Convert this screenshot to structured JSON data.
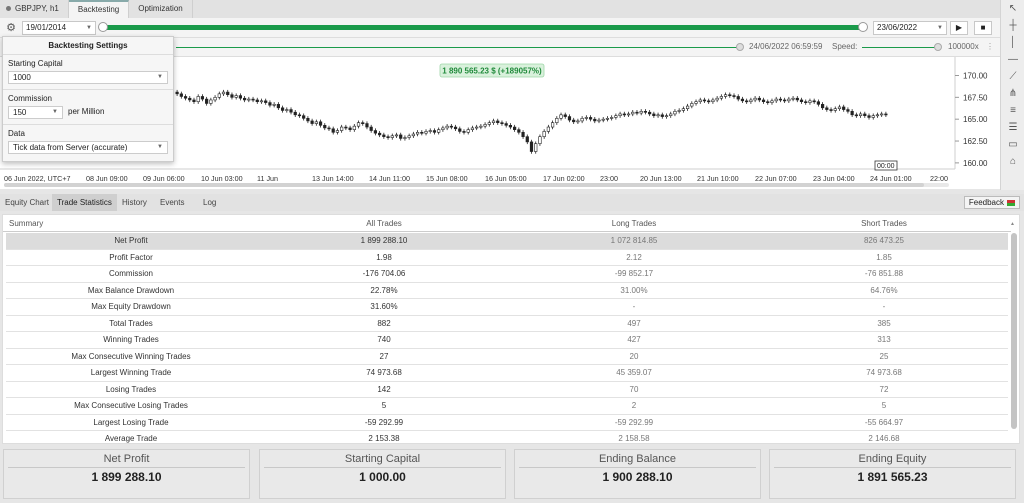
{
  "top_tabs": [
    {
      "label": "GBPJPY, h1"
    },
    {
      "label": "Backtesting"
    },
    {
      "label": "Optimization"
    }
  ],
  "control_bar": {
    "start_date": "19/01/2014",
    "end_date": "23/06/2022",
    "play_icon": "▶",
    "stop_icon": "■"
  },
  "speed_row": {
    "current_time": "24/06/2022 06:59:59",
    "speed_label": "Speed:",
    "speed_value": "100000x"
  },
  "settings": {
    "title": "Backtesting Settings",
    "starting_capital_label": "Starting Capital",
    "starting_capital_value": "1000",
    "commission_label": "Commission",
    "commission_value": "150",
    "commission_unit": "per Million",
    "data_label": "Data",
    "data_value": "Tick data from Server (accurate)"
  },
  "chart": {
    "equity_badge": "1 890 565.23 $ (+189057%)",
    "price_ticks": [
      "170.00",
      "167.50",
      "165.00",
      "162.50",
      "160.00"
    ],
    "time_ticks": [
      "06 Jun 2022, UTC+7",
      "08 Jun 09:00",
      "09 Jun 06:00",
      "10 Jun 03:00",
      "11 Jun",
      "13 Jun 14:00",
      "14 Jun 11:00",
      "15 Jun 08:00",
      "16 Jun 05:00",
      "17 Jun 02:00",
      "23:00",
      "20 Jun 13:00",
      "21 Jun 10:00",
      "22 Jun 07:00",
      "23 Jun 04:00",
      "24 Jun 01:00",
      "22:00"
    ],
    "time_marker": "00:00"
  },
  "chart_data": {
    "type": "candlestick",
    "title": "",
    "y_ticks": [
      160.0,
      162.5,
      165.0,
      167.5,
      170.0
    ],
    "ylim": [
      159.3,
      171.2
    ],
    "grid": false,
    "close": [
      167.9,
      167.6,
      167.4,
      167.2,
      167.0,
      167.6,
      167.3,
      166.8,
      167.2,
      167.5,
      167.9,
      168.1,
      167.8,
      167.5,
      167.7,
      167.4,
      167.2,
      167.3,
      167.2,
      167.0,
      167.1,
      166.9,
      166.6,
      166.7,
      166.3,
      166.0,
      166.1,
      165.8,
      165.5,
      165.4,
      165.1,
      164.8,
      164.5,
      164.7,
      164.3,
      164.0,
      163.9,
      163.5,
      163.7,
      164.1,
      164.0,
      163.8,
      164.2,
      164.6,
      164.5,
      164.1,
      163.7,
      163.4,
      163.2,
      163.0,
      162.9,
      163.1,
      163.2,
      162.8,
      162.9,
      163.1,
      163.3,
      163.5,
      163.4,
      163.6,
      163.7,
      163.5,
      163.8,
      164.0,
      164.2,
      164.1,
      163.9,
      163.6,
      163.5,
      163.8,
      164.0,
      164.1,
      164.2,
      164.4,
      164.6,
      164.8,
      164.6,
      164.5,
      164.3,
      164.1,
      163.8,
      163.5,
      163.0,
      162.4,
      161.3,
      162.2,
      163.0,
      163.6,
      164.1,
      164.6,
      165.1,
      165.5,
      165.3,
      164.9,
      164.7,
      164.8,
      165.1,
      165.2,
      165.0,
      164.8,
      164.9,
      165.0,
      165.1,
      165.2,
      165.4,
      165.6,
      165.5,
      165.6,
      165.8,
      165.7,
      165.9,
      165.8,
      165.6,
      165.4,
      165.5,
      165.3,
      165.4,
      165.6,
      165.9,
      166.0,
      166.2,
      166.5,
      166.8,
      167.0,
      167.2,
      167.1,
      167.0,
      167.2,
      167.4,
      167.6,
      167.8,
      167.7,
      167.6,
      167.3,
      167.1,
      167.0,
      167.2,
      167.4,
      167.2,
      167.0,
      166.9,
      167.1,
      167.3,
      167.2,
      167.1,
      167.3,
      167.4,
      167.2,
      167.0,
      166.9,
      167.1,
      167.0,
      166.7,
      166.3,
      166.1,
      166.0,
      166.2,
      166.4,
      166.1,
      165.9,
      165.5,
      165.4,
      165.6,
      165.4,
      165.2,
      165.4,
      165.5,
      165.6,
      165.5
    ]
  },
  "bottom_tabs": [
    {
      "label": "Equity Chart"
    },
    {
      "label": "Trade Statistics"
    },
    {
      "label": "History"
    },
    {
      "label": "Events"
    },
    {
      "label": "Log"
    }
  ],
  "feedback_label": "Feedback",
  "table": {
    "headers": [
      "Summary",
      "All Trades",
      "Long Trades",
      "Short Trades"
    ],
    "rows": [
      {
        "label": "Net Profit",
        "all": "1 899 288.10",
        "long": "1 072 814.85",
        "short": "826 473.25"
      },
      {
        "label": "Profit Factor",
        "all": "1.98",
        "long": "2.12",
        "short": "1.85"
      },
      {
        "label": "Commission",
        "all": "-176 704.06",
        "long": "-99 852.17",
        "short": "-76 851.88"
      },
      {
        "label": "Max Balance Drawdown",
        "all": "22.78%",
        "long": "31.00%",
        "short": "64.76%"
      },
      {
        "label": "Max Equity Drawdown",
        "all": "31.60%",
        "long": "-",
        "short": "-"
      },
      {
        "label": "Total Trades",
        "all": "882",
        "long": "497",
        "short": "385"
      },
      {
        "label": "Winning Trades",
        "all": "740",
        "long": "427",
        "short": "313"
      },
      {
        "label": "Max Consecutive Winning Trades",
        "all": "27",
        "long": "20",
        "short": "25"
      },
      {
        "label": "Largest Winning Trade",
        "all": "74 973.68",
        "long": "45 359.07",
        "short": "74 973.68"
      },
      {
        "label": "Losing Trades",
        "all": "142",
        "long": "70",
        "short": "72"
      },
      {
        "label": "Max Consecutive Losing Trades",
        "all": "5",
        "long": "2",
        "short": "5"
      },
      {
        "label": "Largest Losing Trade",
        "all": "-59 292.99",
        "long": "-59 292.99",
        "short": "-55 664.97"
      },
      {
        "label": "Average Trade",
        "all": "2 153.38",
        "long": "2 158.58",
        "short": "2 146.68"
      }
    ]
  },
  "cards": [
    {
      "label": "Net Profit",
      "value": "1 899 288.10"
    },
    {
      "label": "Starting Capital",
      "value": "1 000.00"
    },
    {
      "label": "Ending Balance",
      "value": "1 900 288.10"
    },
    {
      "label": "Ending Equity",
      "value": "1 891 565.23"
    }
  ],
  "colors": {
    "accent_green": "#1a9a4a",
    "badge_bg": "#d9f1dc",
    "badge_text": "#1f8a3a"
  }
}
